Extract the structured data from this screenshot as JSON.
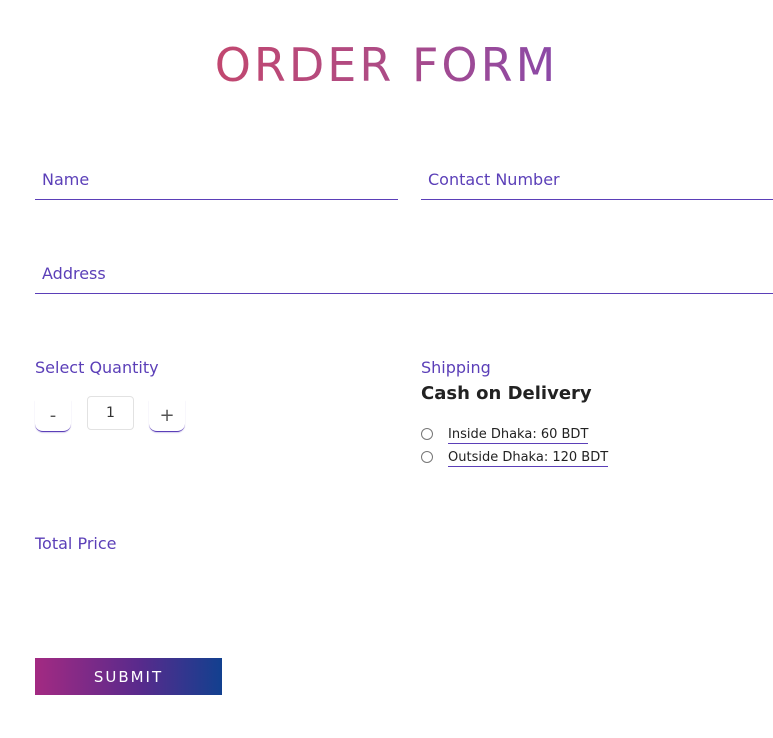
{
  "page": {
    "title": "ORDER FORM"
  },
  "form": {
    "name_placeholder": "Name",
    "contact_placeholder": "Contact Number",
    "address_placeholder": "Address"
  },
  "quantity": {
    "label": "Select Quantity",
    "minus_label": "-",
    "plus_label": "+",
    "value": "1"
  },
  "shipping": {
    "label": "Shipping",
    "heading": "Cash on Delivery",
    "options": [
      {
        "label": "Inside Dhaka: 60 BDT",
        "selected": false
      },
      {
        "label": "Outside Dhaka: 120 BDT",
        "selected": false
      }
    ]
  },
  "total": {
    "label": "Total Price"
  },
  "actions": {
    "submit_label": "SUBMIT"
  },
  "colors": {
    "accent": "#5b3fb8",
    "title_start": "#c2476f",
    "title_end": "#8a49a8",
    "button_start": "#a32a82",
    "button_end": "#12408f"
  }
}
